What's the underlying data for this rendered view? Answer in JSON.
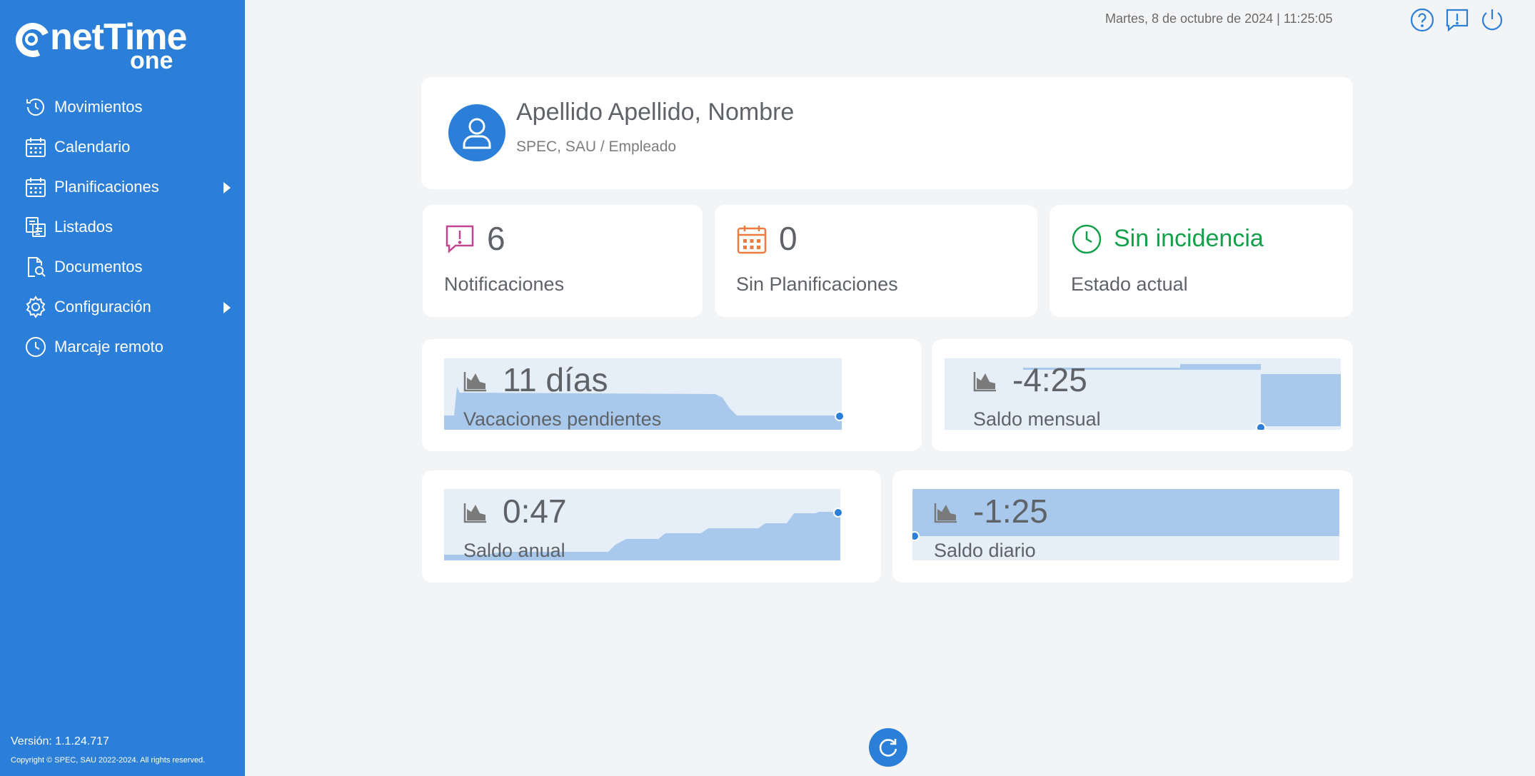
{
  "app": {
    "logo_main": "netTime",
    "logo_sub": "one",
    "version": "Versión: 1.1.24.717",
    "copyright": "Copyright © SPEC, SAU 2022-2024. All rights reserved."
  },
  "sidebar": {
    "items": [
      {
        "label": "Movimientos",
        "icon": "history-icon",
        "has_submenu": false
      },
      {
        "label": "Calendario",
        "icon": "calendar-icon",
        "has_submenu": false
      },
      {
        "label": "Planificaciones",
        "icon": "planning-icon",
        "has_submenu": true
      },
      {
        "label": "Listados",
        "icon": "list-icon",
        "has_submenu": false
      },
      {
        "label": "Documentos",
        "icon": "document-search-icon",
        "has_submenu": false
      },
      {
        "label": "Configuración",
        "icon": "gear-icon",
        "has_submenu": true
      },
      {
        "label": "Marcaje remoto",
        "icon": "clock-icon",
        "has_submenu": false
      }
    ]
  },
  "header": {
    "datetime": "Martes, 8 de octubre de 2024 | 11:25:05",
    "icons": [
      "help-icon",
      "notifications-icon",
      "power-icon"
    ]
  },
  "profile": {
    "name": "Apellido Apellido, Nombre",
    "subtitle": "SPEC, SAU / Empleado"
  },
  "stats": {
    "notifications": {
      "value": "6",
      "label": "Notificaciones",
      "color": "#c2458f"
    },
    "plannings": {
      "value": "0",
      "label": "Sin Planificaciones",
      "color": "#f07b3f"
    },
    "status": {
      "value": "Sin incidencia",
      "label": "Estado actual",
      "color": "#14a04a"
    }
  },
  "kpis": {
    "vacaciones": {
      "value": "11 días",
      "label": "Vacaciones pendientes"
    },
    "mensual": {
      "value": "-4:25",
      "label": "Saldo mensual"
    },
    "anual": {
      "value": "0:47",
      "label": "Saldo anual"
    },
    "diario": {
      "value": "-1:25",
      "label": "Saldo diario"
    }
  },
  "colors": {
    "accent": "#2b7fd8",
    "chart_fill": "#a8c9ec",
    "chart_bg": "#e6eef8"
  }
}
